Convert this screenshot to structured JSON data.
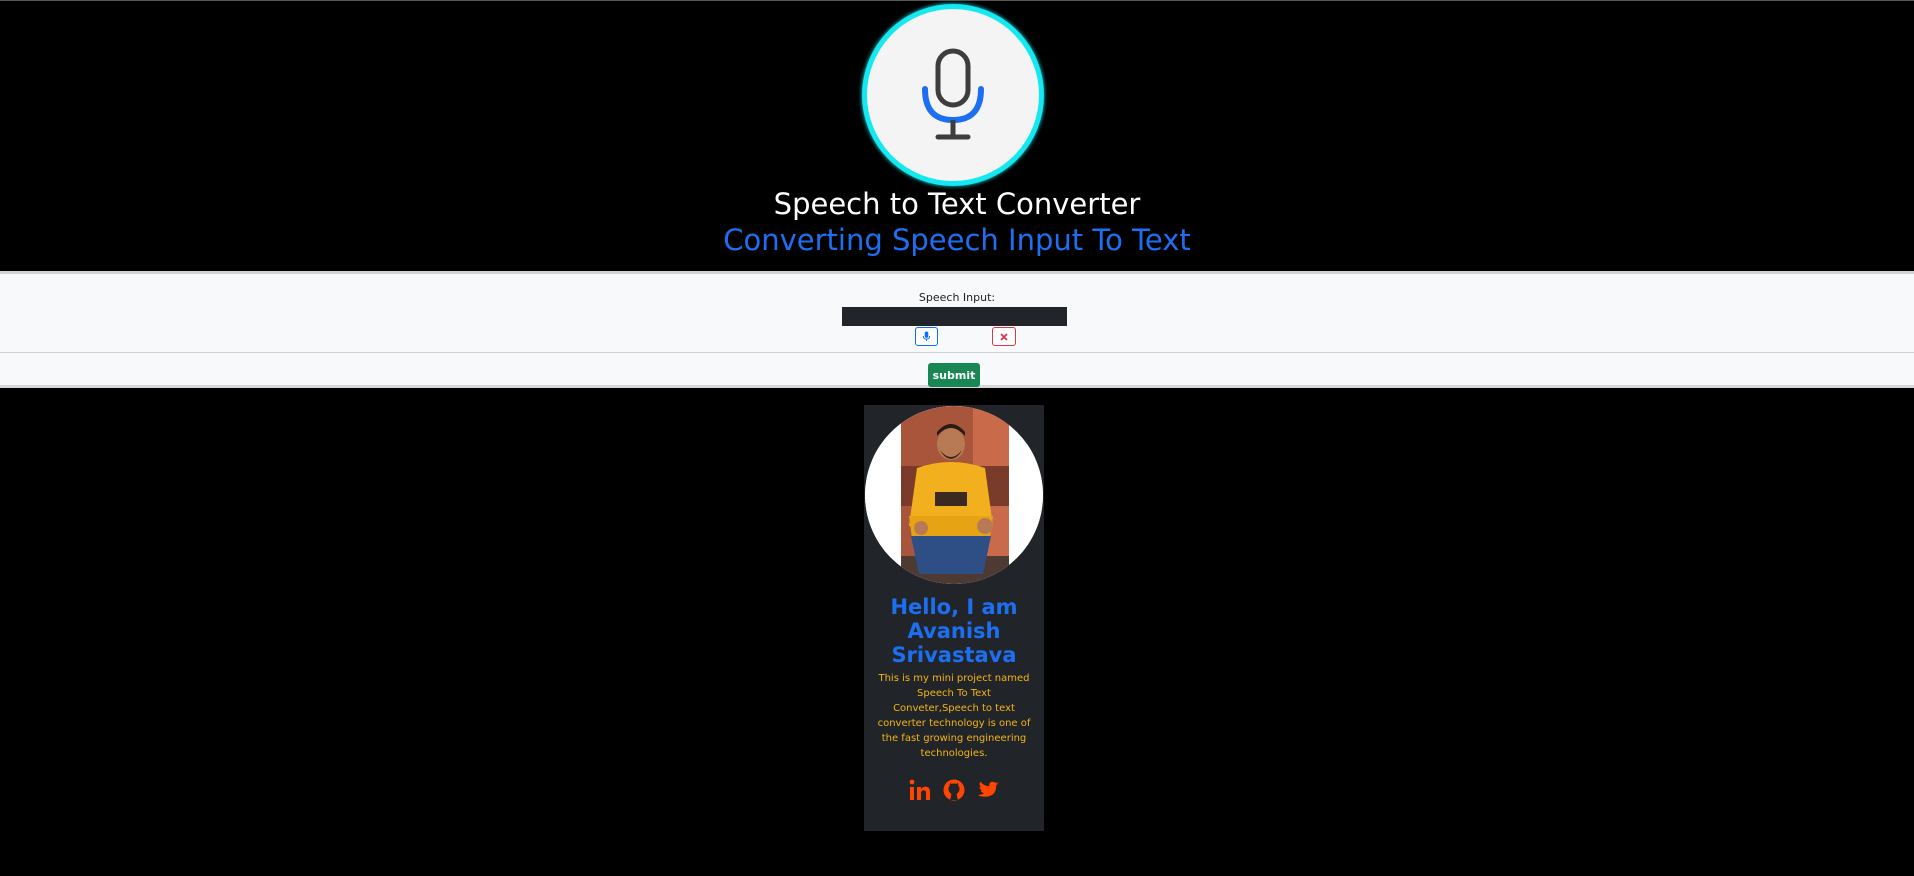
{
  "header": {
    "title": "Speech to Text Converter",
    "subtitle": "Converting Speech Input To Text"
  },
  "form": {
    "label": "Speech Input:",
    "input_value": "",
    "submit_label": "submit"
  },
  "profile": {
    "greeting": "Hello, I am Avanish Srivastava",
    "description": "This is my mini project named Speech To Text Conveter,Speech to text converter technology is one of the fast growing engineering technologies."
  },
  "icons": {
    "logo": "microphone-icon",
    "mic_button": "microphone-icon",
    "clear_button": "close-icon",
    "socials": [
      "linkedin-icon",
      "github-icon",
      "twitter-icon"
    ]
  },
  "colors": {
    "page_background": "#000000",
    "logo_ring": "#14e8f0",
    "accent_blue": "#1d6ff2",
    "submit_green": "#198754",
    "clear_red": "#dc3545",
    "card_background": "#212529",
    "description_text": "#f4b417",
    "social_icons": "#ff4500"
  }
}
